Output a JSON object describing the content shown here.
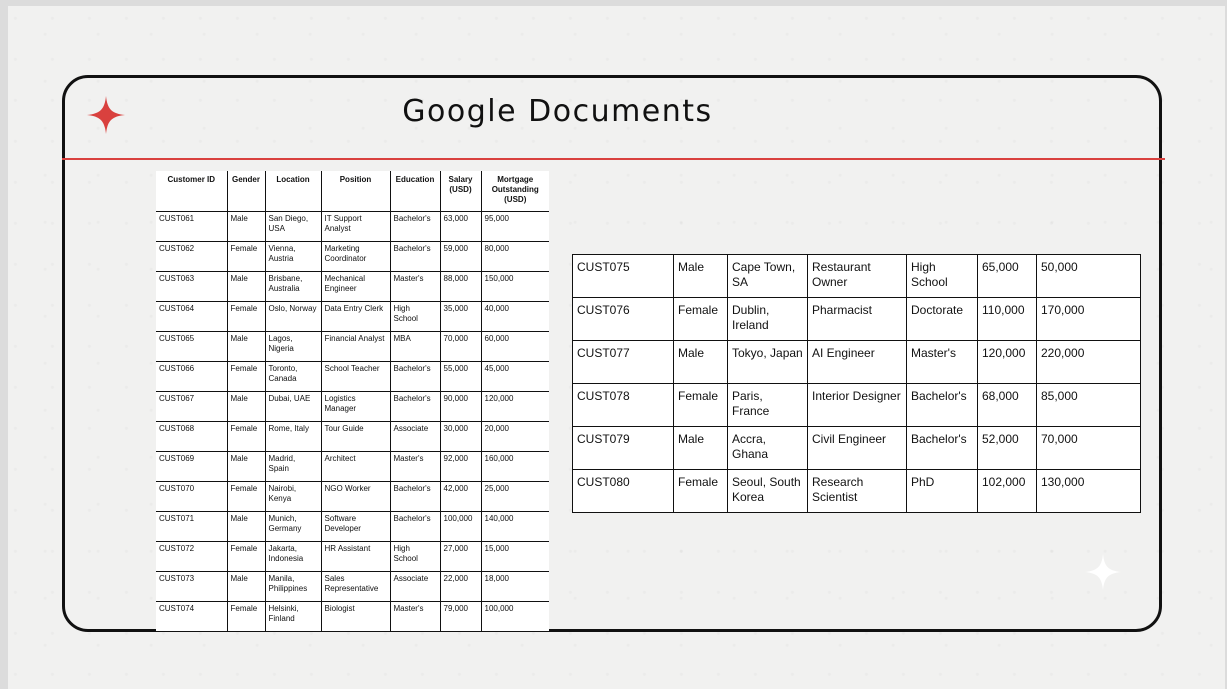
{
  "title": "Google Documents",
  "colors": {
    "accent": "#d9413e",
    "frame": "#111111",
    "background": "#f1f1f0"
  },
  "icons": {
    "top_left": "red-sparkle-icon",
    "bottom_right": "white-sparkle-icon"
  },
  "left_table": {
    "headers": [
      "Customer ID",
      "Gender",
      "Location",
      "Position",
      "Education",
      "Salary (USD)",
      "Mortgage Outstanding (USD)"
    ],
    "rows": [
      [
        "CUST061",
        "Male",
        "San Diego, USA",
        "IT Support Analyst",
        "Bachelor's",
        "63,000",
        "95,000"
      ],
      [
        "CUST062",
        "Female",
        "Vienna, Austria",
        "Marketing Coordinator",
        "Bachelor's",
        "59,000",
        "80,000"
      ],
      [
        "CUST063",
        "Male",
        "Brisbane, Australia",
        "Mechanical Engineer",
        "Master's",
        "88,000",
        "150,000"
      ],
      [
        "CUST064",
        "Female",
        "Oslo, Norway",
        "Data Entry Clerk",
        "High School",
        "35,000",
        "40,000"
      ],
      [
        "CUST065",
        "Male",
        "Lagos, Nigeria",
        "Financial Analyst",
        "MBA",
        "70,000",
        "60,000"
      ],
      [
        "CUST066",
        "Female",
        "Toronto, Canada",
        "School Teacher",
        "Bachelor's",
        "55,000",
        "45,000"
      ],
      [
        "CUST067",
        "Male",
        "Dubai, UAE",
        "Logistics Manager",
        "Bachelor's",
        "90,000",
        "120,000"
      ],
      [
        "CUST068",
        "Female",
        "Rome, Italy",
        "Tour Guide",
        "Associate",
        "30,000",
        "20,000"
      ],
      [
        "CUST069",
        "Male",
        "Madrid, Spain",
        "Architect",
        "Master's",
        "92,000",
        "160,000"
      ],
      [
        "CUST070",
        "Female",
        "Nairobi, Kenya",
        "NGO Worker",
        "Bachelor's",
        "42,000",
        "25,000"
      ],
      [
        "CUST071",
        "Male",
        "Munich, Germany",
        "Software Developer",
        "Bachelor's",
        "100,000",
        "140,000"
      ],
      [
        "CUST072",
        "Female",
        "Jakarta, Indonesia",
        "HR Assistant",
        "High School",
        "27,000",
        "15,000"
      ],
      [
        "CUST073",
        "Male",
        "Manila, Philippines",
        "Sales Representative",
        "Associate",
        "22,000",
        "18,000"
      ],
      [
        "CUST074",
        "Female",
        "Helsinki, Finland",
        "Biologist",
        "Master's",
        "79,000",
        "100,000"
      ]
    ]
  },
  "right_table": {
    "rows": [
      [
        "CUST075",
        "Male",
        "Cape Town, SA",
        "Restaurant Owner",
        "High School",
        "65,000",
        "50,000"
      ],
      [
        "CUST076",
        "Female",
        "Dublin, Ireland",
        "Pharmacist",
        "Doctorate",
        "110,000",
        "170,000"
      ],
      [
        "CUST077",
        "Male",
        "Tokyo, Japan",
        "AI Engineer",
        "Master's",
        "120,000",
        "220,000"
      ],
      [
        "CUST078",
        "Female",
        "Paris, France",
        "Interior Designer",
        "Bachelor's",
        "68,000",
        "85,000"
      ],
      [
        "CUST079",
        "Male",
        "Accra, Ghana",
        "Civil Engineer",
        "Bachelor's",
        "52,000",
        "70,000"
      ],
      [
        "CUST080",
        "Female",
        "Seoul, South Korea",
        "Research Scientist",
        "PhD",
        "102,000",
        "130,000"
      ]
    ]
  }
}
